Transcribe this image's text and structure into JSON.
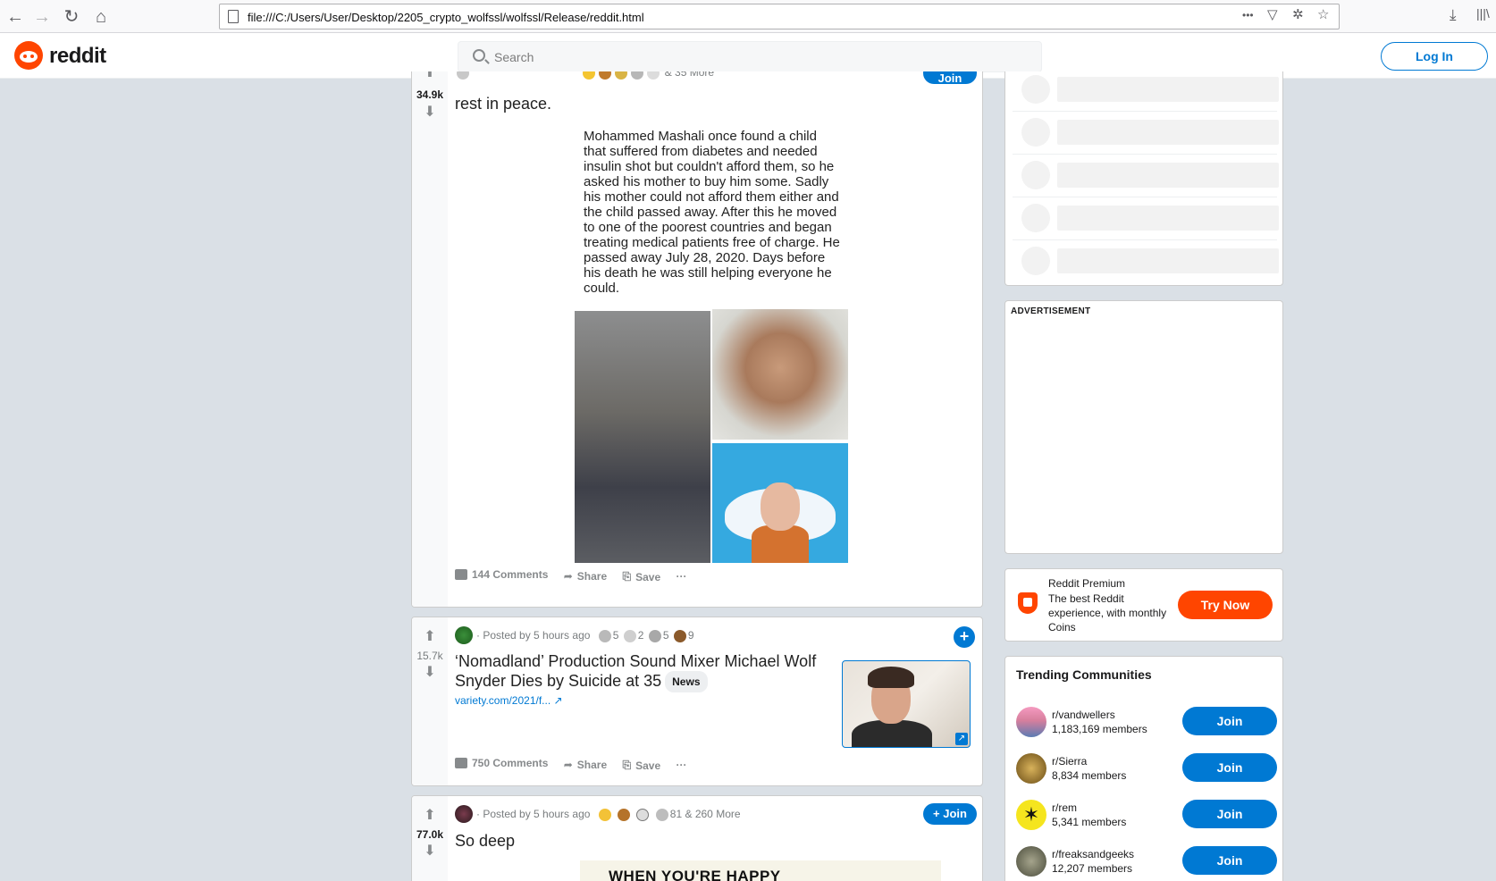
{
  "browser": {
    "url": "file:///C:/Users/User/Desktop/2205_crypto_wolfssl/wolfssl/Release/reddit.html",
    "more_actions": "•••"
  },
  "header": {
    "logo_text": "reddit",
    "search_placeholder": "Search",
    "login_label": "Log In"
  },
  "posts": [
    {
      "score": "34.9k",
      "partial_meta": "& 35 More",
      "partial_join": "Join",
      "title": "rest in peace.",
      "image_text": "Mohammed Mashali once found a child that suffered from diabetes and needed insulin shot but couldn't afford them, so he asked his mother to buy him some. Sadly his mother could not afford them either and the child passed away. After this he moved to one of the poorest countries and began treating medical patients free of charge. He passed away July 28, 2020. Days before his death he was still helping everyone he could.",
      "comments": "144 Comments",
      "share": "Share",
      "save": "Save",
      "more": "···"
    },
    {
      "score": "15.7k",
      "posted": "· Posted by 5 hours ago",
      "awards": [
        "5",
        "2",
        "5",
        "9"
      ],
      "title": "‘Nomadland’ Production Sound Mixer Michael Wolf Snyder Dies by Suicide at 35",
      "flair": "News",
      "link": "variety.com/2021/f...",
      "comments": "750 Comments",
      "share": "Share",
      "save": "Save",
      "more": "···",
      "join": "+"
    },
    {
      "score": "77.0k",
      "posted": "· Posted by 5 hours ago",
      "awards_count": "81",
      "awards_more": "& 260 More",
      "title": "So deep",
      "join": "+ Join",
      "meme_text": "WHEN YOU'RE HAPPY"
    }
  ],
  "sidebar": {
    "advertisement": "ADVERTISEMENT",
    "premium": {
      "title": "Reddit Premium",
      "desc": "The best Reddit experience, with monthly Coins",
      "button": "Try Now"
    },
    "trending": {
      "title": "Trending Communities",
      "join_label": "Join",
      "communities": [
        {
          "name": "r/vandwellers",
          "members": "1,183,169 members"
        },
        {
          "name": "r/Sierra",
          "members": "8,834 members"
        },
        {
          "name": "r/rem",
          "members": "5,341 members"
        },
        {
          "name": "r/freaksandgeeks",
          "members": "12,207 members"
        }
      ]
    }
  }
}
